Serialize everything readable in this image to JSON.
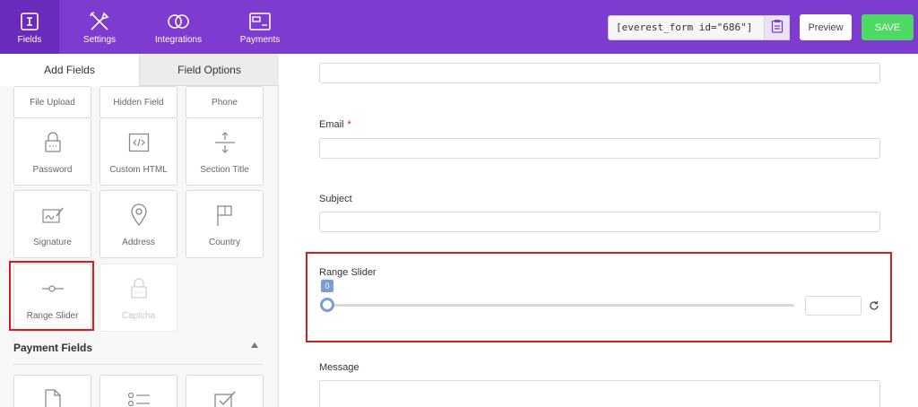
{
  "nav": {
    "fields": "Fields",
    "settings": "Settings",
    "integrations": "Integrations",
    "payments": "Payments"
  },
  "toolbar": {
    "shortcode": "[everest_form id=\"686\"]",
    "preview": "Preview",
    "save": "SAVE"
  },
  "sidebar": {
    "tabs": {
      "add_fields": "Add Fields",
      "field_options": "Field Options"
    },
    "fields": {
      "file_upload": "File Upload",
      "hidden_field": "Hidden Field",
      "phone": "Phone",
      "password": "Password",
      "custom_html": "Custom HTML",
      "section_title": "Section Title",
      "signature": "Signature",
      "address": "Address",
      "country": "Country",
      "range_slider": "Range Slider",
      "captcha": "Captcha"
    },
    "payment_section": "Payment Fields"
  },
  "form": {
    "email_label": "Email",
    "required_mark": "*",
    "subject_label": "Subject",
    "range_label": "Range Slider",
    "range_value": "0",
    "range_fraction": 0,
    "message_label": "Message"
  },
  "colors": {
    "topbar": "#7e3bd0",
    "save": "#4cd964",
    "highlight": "#d11e1e",
    "slider": "#7c9dcf"
  }
}
